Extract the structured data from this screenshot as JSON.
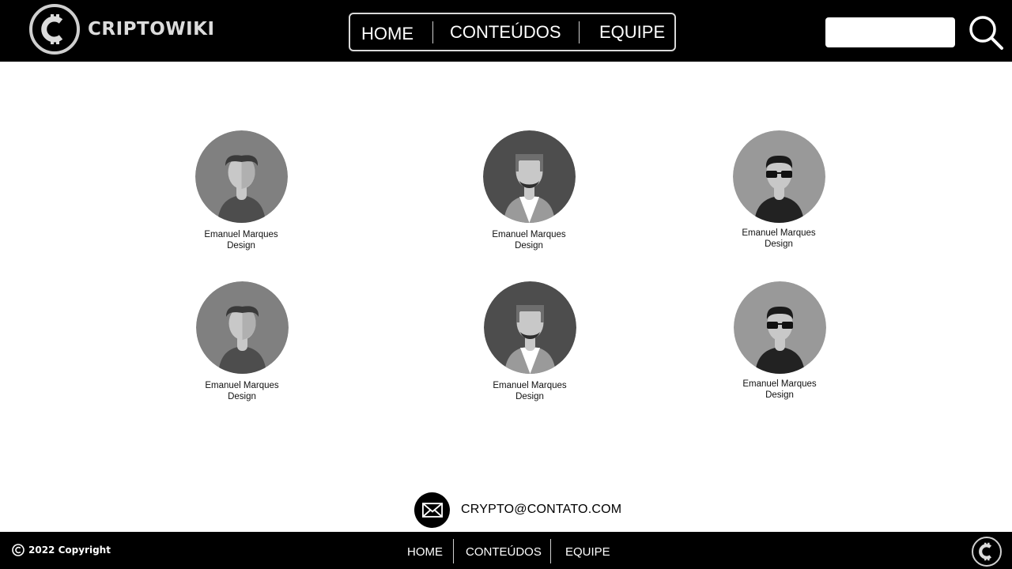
{
  "brand": {
    "name": "CRIPTOWIKI",
    "logo_icon": "cent-coin-icon"
  },
  "nav": {
    "home": "HOME",
    "conteudos": "CONTEÚDOS",
    "equipe": "EQUIPE"
  },
  "search": {
    "value": "",
    "icon": "search-icon"
  },
  "team": [
    {
      "name": "Emanuel Marques",
      "role": "Design",
      "avatar": "avatar-short-hair"
    },
    {
      "name": "Emanuel Marques",
      "role": "Design",
      "avatar": "avatar-beard"
    },
    {
      "name": "Emanuel Marques",
      "role": "Design",
      "avatar": "avatar-sunglasses"
    },
    {
      "name": "Emanuel Marques",
      "role": "Design",
      "avatar": "avatar-short-hair"
    },
    {
      "name": "Emanuel Marques",
      "role": "Design",
      "avatar": "avatar-beard"
    },
    {
      "name": "Emanuel Marques",
      "role": "Design",
      "avatar": "avatar-sunglasses"
    }
  ],
  "contact": {
    "email": "CRYPTO@CONTATO.COM",
    "icon": "mail-icon"
  },
  "footer": {
    "copyright": "2022 Copyright",
    "nav": {
      "home": "HOME",
      "conteudos": "CONTEÚDOS",
      "equipe": "EQUIPE"
    }
  },
  "colors": {
    "header_bg": "#000000",
    "page_bg": "#ffffff",
    "avatar_light": "#808080",
    "avatar_dark": "#4d4d4d",
    "avatar_mid": "#999999"
  }
}
